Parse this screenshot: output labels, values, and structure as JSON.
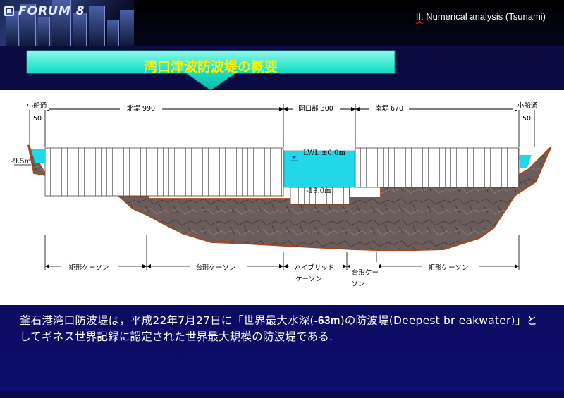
{
  "header": {
    "logo_text": "FORUM 8",
    "section_prefix": "II.",
    "section_title": " Numerical analysis (Tsunami)"
  },
  "banner": {
    "title": "湾口津波防波堤の概要",
    "color_fill": "#19e0c8",
    "color_text": "#fff000"
  },
  "diagram": {
    "dimensions": {
      "small_channel_left": "小船通",
      "small_channel_left_width": "50",
      "north_breakwater": "北堤  990",
      "opening": "開口部  300",
      "south_breakwater": "南堤  670",
      "small_channel_right": "小船通",
      "small_channel_right_width": "50"
    },
    "water_level": "LWL ±0.0m",
    "depth_left": "-9.5m",
    "depth_opening": "-19.0m",
    "depth_opening_dash": "-",
    "segments": {
      "rect_caisson_left": "矩形ケーソン",
      "trap_caisson_left": "台形ケーソン",
      "hybrid_caisson_line1": "ハイブリッド",
      "hybrid_caisson_line2": "ケーソン",
      "trap_caisson_right_line1": "台形ケー",
      "trap_caisson_right_line2": "ソン",
      "rect_caisson_right": "矩形ケーソン"
    },
    "colors": {
      "water": "#22d8e8",
      "rock": "#6a5a58",
      "outline": "#b04a10"
    }
  },
  "caption": {
    "part1": "釜石港湾口防波堤は，平成22年7月27日に「世界最大水深(",
    "depth_bold": "-63m",
    "part2": ")の防波堤(Deepest  br eakwater)」としてギネス世界記録に認定された世界最大規模の防波堤である."
  }
}
